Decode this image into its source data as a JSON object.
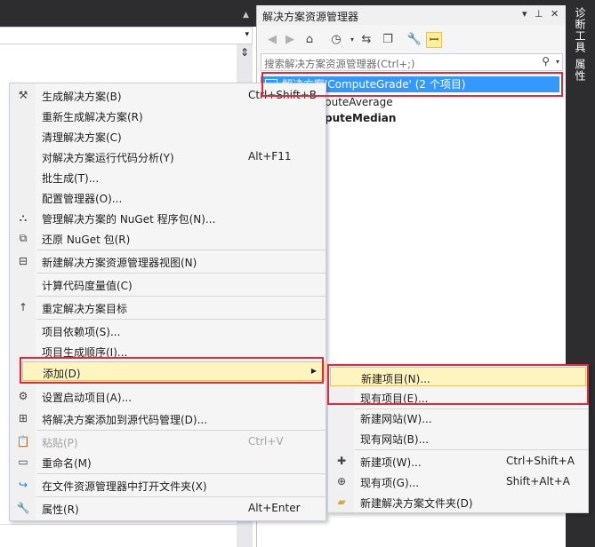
{
  "editor": {
    "split_glyph": "⇕"
  },
  "solution_explorer": {
    "title": "解决方案资源管理器",
    "pin_glyph": "▾",
    "pushpin_glyph": "ꟷ",
    "close_glyph": "✕",
    "search": {
      "placeholder": "搜索解决方案资源管理器(Ctrl+;)"
    },
    "tree": [
      {
        "label": "解决方案'ComputeGrade' (2 个项目)"
      },
      {
        "label": "puteAverage"
      },
      {
        "label": "puteMedian"
      }
    ]
  },
  "side_tabs": [
    "诊断工具",
    "属性"
  ],
  "context_menu": {
    "items": [
      {
        "label": "生成解决方案(B)",
        "shortcut": "Ctrl+Shift+B"
      },
      {
        "label": "重新生成解决方案(R)",
        "shortcut": ""
      },
      {
        "label": "清理解决方案(C)",
        "shortcut": ""
      },
      {
        "label": "对解决方案运行代码分析(Y)",
        "shortcut": "Alt+F11"
      },
      {
        "label": "批生成(T)...",
        "shortcut": ""
      },
      {
        "label": "配置管理器(O)...",
        "shortcut": ""
      },
      {
        "label": "管理解决方案的 NuGet 程序包(N)...",
        "shortcut": ""
      },
      {
        "label": "还原 NuGet 包(R)",
        "shortcut": ""
      },
      {
        "label": "新建解决方案资源管理器视图(N)",
        "shortcut": ""
      },
      {
        "label": "计算代码度量值(C)",
        "shortcut": ""
      },
      {
        "label": "重定解决方案目标",
        "shortcut": ""
      },
      {
        "label": "项目依赖项(S)...",
        "shortcut": ""
      },
      {
        "label": "项目生成顺序(I)...",
        "shortcut": ""
      },
      {
        "label": "添加(D)",
        "shortcut": ""
      },
      {
        "label": "设置启动项目(A)...",
        "shortcut": ""
      },
      {
        "label": "将解决方案添加到源代码管理(D)...",
        "shortcut": ""
      },
      {
        "label": "粘贴(P)",
        "shortcut": "Ctrl+V"
      },
      {
        "label": "重命名(M)",
        "shortcut": ""
      },
      {
        "label": "在文件资源管理器中打开文件夹(X)",
        "shortcut": ""
      },
      {
        "label": "属性(R)",
        "shortcut": "Alt+Enter"
      }
    ]
  },
  "add_submenu": {
    "items": [
      {
        "label": "新建项目(N)...",
        "shortcut": ""
      },
      {
        "label": "现有项目(E)...",
        "shortcut": ""
      },
      {
        "label": "新建网站(W)...",
        "shortcut": ""
      },
      {
        "label": "现有网站(B)...",
        "shortcut": ""
      },
      {
        "label": "新建项(W)...",
        "shortcut": "Ctrl+Shift+A"
      },
      {
        "label": "现有项(G)...",
        "shortcut": "Shift+Alt+A"
      },
      {
        "label": "新建解决方案文件夹(D)",
        "shortcut": ""
      }
    ]
  },
  "colors": {
    "highlight_box": "#e0293c",
    "selection": "#3399ff",
    "hover": "#fdf4bf"
  }
}
